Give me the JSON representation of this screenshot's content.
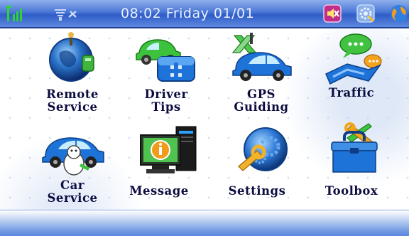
{
  "statusbar": {
    "clock": "08:02 Friday 01/01",
    "icons": [
      "signal-icon",
      "gps-no-fix-icon",
      "volume-mute-icon",
      "settings-icon",
      "globe-icon"
    ]
  },
  "menu": {
    "items": [
      {
        "label": "Remote\nService",
        "icon": "remote-service-icon"
      },
      {
        "label": "Driver\nTips",
        "icon": "driver-tips-icon"
      },
      {
        "label": "GPS\nGuiding",
        "icon": "gps-guiding-icon"
      },
      {
        "label": "Traffic",
        "icon": "traffic-icon"
      },
      {
        "label": "Car\nService",
        "icon": "car-service-icon"
      },
      {
        "label": "Message",
        "icon": "message-icon"
      },
      {
        "label": "Settings",
        "icon": "settings-gear-icon"
      },
      {
        "label": "Toolbox",
        "icon": "toolbox-icon"
      }
    ]
  },
  "colors": {
    "statusbar": "#3a66cf",
    "label": "#0d0d40",
    "accent_green": "#3cc23c",
    "accent_blue": "#1e73d8"
  }
}
